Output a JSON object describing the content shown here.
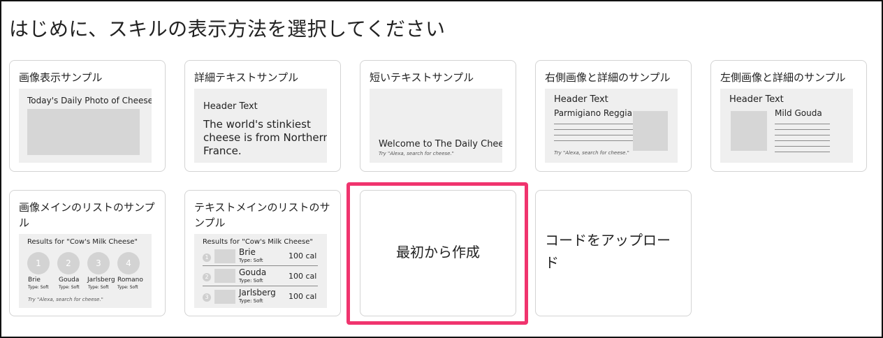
{
  "header": {
    "title": "はじめに、スキルの表示方法を選択してください"
  },
  "templates": {
    "image_display": {
      "label": "画像表示サンプル",
      "caption": "Today's Daily Photo of Cheese"
    },
    "detail_text": {
      "label": "詳細テキストサンプル",
      "header": "Header Text",
      "body_line1": "The world's stinkiest",
      "body_line2": "cheese is from Northern",
      "body_line3": "France."
    },
    "short_text": {
      "label": "短いテキストサンプル",
      "body": "Welcome to The Daily Cheese",
      "hint": "Try \"Alexa, search for cheese.\""
    },
    "right_image_detail": {
      "label": "右側画像と詳細のサンプル",
      "header": "Header Text",
      "title": "Parmigiano Reggiano",
      "hint": "Try \"Alexa, search for cheese.\""
    },
    "left_image_detail": {
      "label": "左側画像と詳細のサンプル",
      "header": "Header Text",
      "title": "Mild Gouda"
    },
    "image_list": {
      "label": "画像メインのリストのサンプル",
      "results": "Results for \"Cow's Milk Cheese\"",
      "items": [
        {
          "num": "1",
          "name": "Brie",
          "type": "Type: Soft"
        },
        {
          "num": "2",
          "name": "Gouda",
          "type": "Type: Soft"
        },
        {
          "num": "3",
          "name": "Jarlsberg",
          "type": "Type: Soft"
        },
        {
          "num": "4",
          "name": "Romano",
          "type": "Type: Soft"
        }
      ],
      "hint": "Try \"Alexa, search for cheese.\""
    },
    "text_list": {
      "label": "テキストメインのリストのサンプル",
      "results": "Results for \"Cow's Milk Cheese\"",
      "items": [
        {
          "num": "1",
          "name": "Brie",
          "type": "Type: Soft",
          "cal": "100 cal"
        },
        {
          "num": "2",
          "name": "Gouda",
          "type": "Type: Soft",
          "cal": "100 cal"
        },
        {
          "num": "3",
          "name": "Jarlsberg",
          "type": "Type: Soft",
          "cal": "100 cal"
        }
      ]
    },
    "from_scratch": {
      "label": "最初から作成"
    },
    "upload_code": {
      "label": "コードをアップロード"
    }
  },
  "colors": {
    "highlight": "#f0346e",
    "card_border": "#d3d3d3",
    "preview_bg": "#efefef"
  }
}
